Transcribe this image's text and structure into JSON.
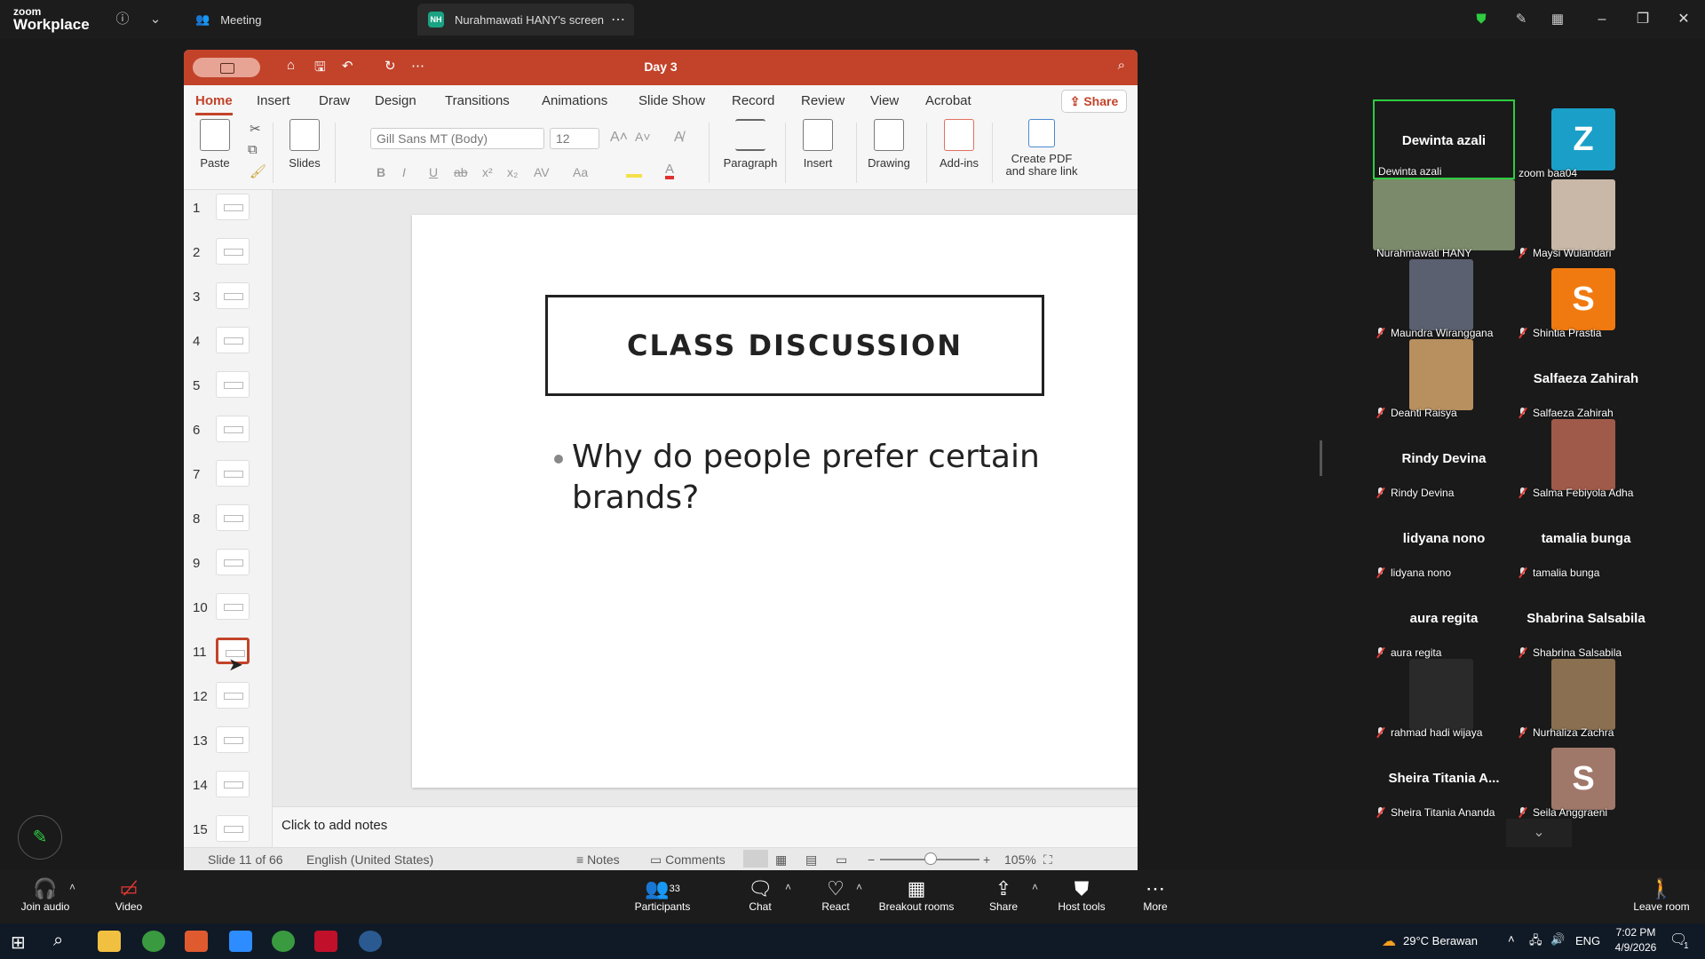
{
  "zoom": {
    "brand_small": "zoom",
    "brand_large": "Workplace",
    "tabs": [
      {
        "label": "Meeting"
      },
      {
        "label": "Nurahmawati HANY's screen",
        "badge": "NH"
      }
    ]
  },
  "ppt": {
    "doc_title": "Day 3",
    "ribbon_tabs": [
      "Home",
      "Insert",
      "Draw",
      "Design",
      "Transitions",
      "Animations",
      "Slide Show",
      "Record",
      "Review",
      "View",
      "Acrobat"
    ],
    "share_label": "Share",
    "groups": {
      "paste": "Paste",
      "slides": "Slides",
      "paragraph": "Paragraph",
      "insert": "Insert",
      "drawing": "Drawing",
      "addins": "Add-ins",
      "create_pdf_line1": "Create PDF",
      "create_pdf_line2": "and share link"
    },
    "font_name": "Gill Sans MT (Body)",
    "font_size": "12",
    "format_buttons": [
      "B",
      "I",
      "U",
      "ab",
      "x²",
      "x₂",
      "AV",
      "Aa"
    ],
    "thumbnail_numbers": [
      "1",
      "2",
      "3",
      "4",
      "5",
      "6",
      "7",
      "8",
      "9",
      "10",
      "11",
      "12",
      "13",
      "14",
      "15"
    ],
    "selected_slide": 11,
    "slide": {
      "title": "CLASS DISCUSSION",
      "bullet": "Why do people prefer certain brands?"
    },
    "notes_placeholder": "Click to add notes",
    "status": {
      "slide_of": "Slide 11 of 66",
      "language": "English (United States)",
      "notes": "Notes",
      "comments": "Comments",
      "zoom_level": "105%"
    }
  },
  "gallery": {
    "participants": [
      {
        "display": "Dewinta azali",
        "label": "Dewinta azali",
        "muted": false,
        "active": true
      },
      {
        "display": "Z",
        "label": "zoom baa04",
        "muted": false,
        "avatar_color": "#1aa0c8"
      },
      {
        "display": "",
        "label": "Nurahmawati HANY",
        "muted": false,
        "photo_color": "#7a8a6a"
      },
      {
        "display": "",
        "label": "Maysi Wulandari",
        "muted": true,
        "photo_color": "#c9b8a8"
      },
      {
        "display": "",
        "label": "Maundra Wiranggana",
        "muted": true,
        "photo_color": "#5a6070"
      },
      {
        "display": "S",
        "label": "Shintia Prastia",
        "muted": true,
        "avatar_color": "#f07a10"
      },
      {
        "display": "",
        "label": "Deanti Raisya",
        "muted": true,
        "photo_color": "#b89060"
      },
      {
        "display": "Salfaeza Zahirah",
        "label": "Salfaeza Zahirah",
        "muted": true
      },
      {
        "display": "Rindy Devina",
        "label": "Rindy Devina",
        "muted": true
      },
      {
        "display": "",
        "label": "Salma Febiyola Adha",
        "muted": true,
        "photo_color": "#a05a4a"
      },
      {
        "display": "lidyana nono",
        "label": "lidyana nono",
        "muted": true
      },
      {
        "display": "tamalia bunga",
        "label": "tamalia bunga",
        "muted": true
      },
      {
        "display": "aura regita",
        "label": "aura regita",
        "muted": true
      },
      {
        "display": "Shabrina Salsabila",
        "label": "Shabrina Salsabila",
        "muted": true
      },
      {
        "display": "",
        "label": "rahmad hadi wijaya",
        "muted": true,
        "photo_color": "#2a2a2a"
      },
      {
        "display": "",
        "label": "Nurhaliza Zachra",
        "muted": true,
        "photo_color": "#8a7050"
      },
      {
        "display": "Sheira Titania A...",
        "label": "Sheira Titania Ananda",
        "muted": true
      },
      {
        "display": "S",
        "label": "Seila Anggraeni",
        "muted": true,
        "avatar_color": "#a0786a"
      }
    ]
  },
  "toolbar": {
    "join_audio": "Join audio",
    "video": "Video",
    "participants": "Participants",
    "participants_count": "33",
    "chat": "Chat",
    "react": "React",
    "breakout": "Breakout rooms",
    "share": "Share",
    "host_tools": "Host tools",
    "more": "More",
    "leave": "Leave room"
  },
  "taskbar": {
    "weather": "29°C Berawan",
    "lang": "ENG",
    "time": "7:02 PM",
    "date": "4/9/2026",
    "notif_count": "1"
  }
}
